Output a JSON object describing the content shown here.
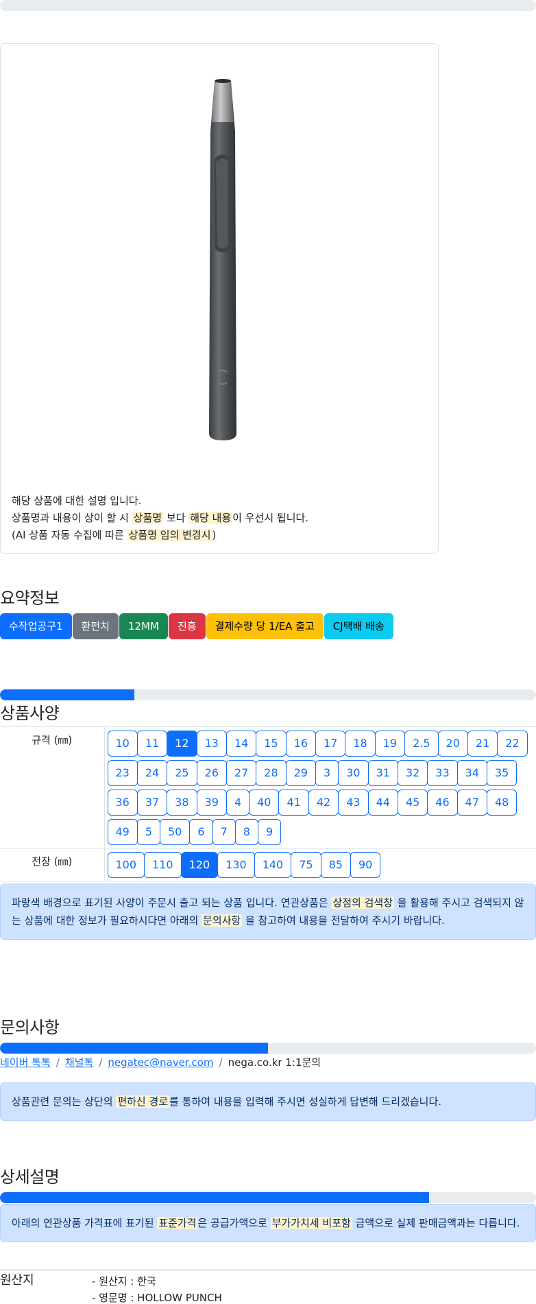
{
  "product": {
    "image_alt": "hollow punch",
    "desc_line1": "해당 상품에 대한 설명 입니다.",
    "desc_line2_a": "상품명과 내용이 상이 할 시 ",
    "desc_line2_hl1": "상품명",
    "desc_line2_b": " 보다 ",
    "desc_line2_hl2": "해당 내용",
    "desc_line2_c": "이 우선시 됩니다.",
    "desc_line3_a": "(AI 상품 자동 수집에 따른 ",
    "desc_line3_hl": "상품명 임의 변경시",
    "desc_line3_b": ")"
  },
  "summary": {
    "title": "요약정보",
    "badges": [
      {
        "label": "수작업공구1",
        "color": "#0d6efd",
        "text": "#ffffff"
      },
      {
        "label": "환펀치",
        "color": "#6c757d",
        "text": "#ffffff"
      },
      {
        "label": "12MM",
        "color": "#198754",
        "text": "#ffffff"
      },
      {
        "label": "진흥",
        "color": "#dc3545",
        "text": "#ffffff"
      },
      {
        "label": "결제수량 당 1/EA 출고",
        "color": "#ffc107",
        "text": "#000000"
      },
      {
        "label": "CJ택배 배송",
        "color": "#0dcaf0",
        "text": "#000000"
      }
    ]
  },
  "spec": {
    "title": "상품사양",
    "progress": 0.25,
    "rows": [
      {
        "label": "규격 (㎜)",
        "options": [
          "10",
          "11",
          "12",
          "13",
          "14",
          "15",
          "16",
          "17",
          "18",
          "19",
          "2.5",
          "20",
          "21",
          "22",
          "23",
          "24",
          "25",
          "26",
          "27",
          "28",
          "29",
          "3",
          "30",
          "31",
          "32",
          "33",
          "34",
          "35",
          "36",
          "37",
          "38",
          "39",
          "4",
          "40",
          "41",
          "42",
          "43",
          "44",
          "45",
          "46",
          "47",
          "48",
          "49",
          "5",
          "50",
          "6",
          "7",
          "8",
          "9"
        ],
        "selected": "12"
      },
      {
        "label": "전장 (㎜)",
        "options": [
          "100",
          "110",
          "120",
          "130",
          "140",
          "75",
          "85",
          "90"
        ],
        "selected": "120"
      }
    ],
    "notice_a": "파랑색 배경으로 표기된 사양이 주문시 출고 되는 상품 입니다. 연관상품은 ",
    "notice_hl1": "상점의 검색창",
    "notice_b": " 을 활용해 주시고 검색되지 않는 상품에 대한 정보가 필요하시다면 아래의 ",
    "notice_hl2": "문의사항",
    "notice_c": " 을 참고하여 내용을 전달하여 주시기 바랍니다."
  },
  "inquiry": {
    "title": "문의사항",
    "progress": 0.5,
    "link1": "네이버 톡톡",
    "link2": "채널톡",
    "link3": "negatec@naver.com",
    "plain": "nega.co.kr 1:1문의",
    "sep": "/",
    "notice_a": "상품관련 문의는 상단의 ",
    "notice_hl": "편하신 경로",
    "notice_b": "를 통하여 내용을 입력해 주시면 성실하게 답변해 드리겠습니다."
  },
  "detail": {
    "title": "상세설명",
    "progress": 0.8,
    "notice_a": "아래의 연관상품 가격표에 표기된 ",
    "notice_hl1": "표준가격",
    "notice_b": "은 공급가액으로 ",
    "notice_hl2": "부가가치세 비포함",
    "notice_c": " 금액으로 실제 판매금액과는 다릅니다."
  },
  "origin": {
    "label": "원산지",
    "line1": "- 원산지 : 한국",
    "line2": "- 영문명 : HOLLOW PUNCH"
  }
}
